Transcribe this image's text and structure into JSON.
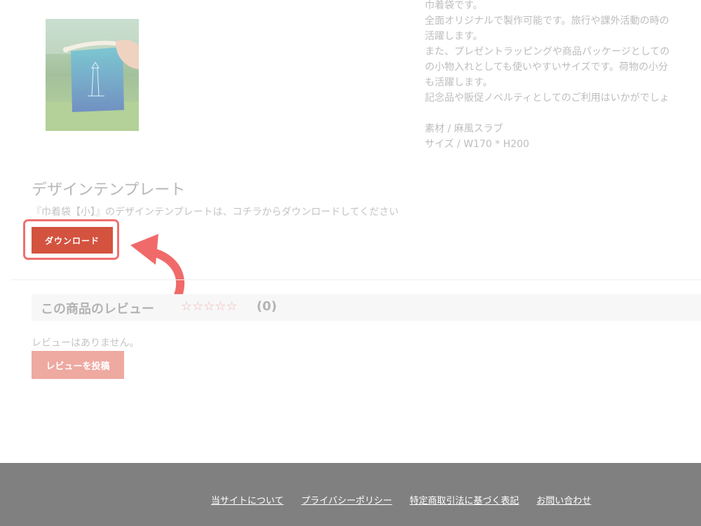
{
  "product": {
    "description_lines": [
      "巾着袋です。",
      "全面オリジナルで製作可能です。旅行や課外活動の時の",
      "活躍します。",
      "また、プレゼントラッピングや商品パッケージとしての",
      "の小物入れとしても使いやすいサイズです。荷物の小分",
      "も活躍します。",
      "記念品や販促ノベルティとしてのご利用はいかがでしょ"
    ],
    "material": "素材 / 麻風スラブ",
    "size": "サイズ / W170 * H200"
  },
  "template": {
    "title": "デザインテンプレート",
    "note": "『巾着袋【小】』のデザインテンプレートは、コチラからダウンロードしてください",
    "download_label": "ダウンロード"
  },
  "reviews": {
    "title": "この商品のレビュー",
    "stars": "☆☆☆☆☆",
    "count": "(0)",
    "empty_message": "レビューはありません。",
    "post_label": "レビューを投稿"
  },
  "footer": {
    "links": [
      "当サイトについて",
      "プライバシーポリシー",
      "特定商取引法に基づく表記",
      "お問い合わせ"
    ]
  },
  "colors": {
    "download_button": "#d4533f",
    "highlight": "#f07070",
    "post_button": "#eea9a1",
    "footer_bg": "#808080"
  }
}
